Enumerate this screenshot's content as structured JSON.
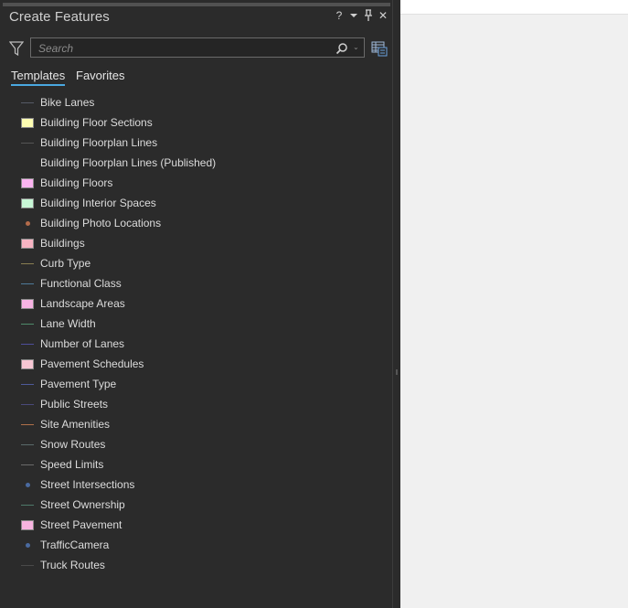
{
  "pane": {
    "title": "Create Features",
    "title_buttons": {
      "help": "?",
      "menu_icon": "chevron-down-icon",
      "pin_icon": "pin-icon",
      "close": "✕"
    }
  },
  "search": {
    "placeholder": "Search",
    "filter_icon": "filter-icon",
    "search_icon": "search-icon",
    "options_icon": "table-icon"
  },
  "tabs": [
    {
      "label": "Templates",
      "active": true
    },
    {
      "label": "Favorites",
      "active": false
    }
  ],
  "templates": [
    {
      "label": "Bike Lanes",
      "sym": "line",
      "color": "#555a66"
    },
    {
      "label": "Building Floor Sections",
      "sym": "poly",
      "color": "#ffffb3"
    },
    {
      "label": "Building Floorplan Lines",
      "sym": "line",
      "color": "#555555"
    },
    {
      "label": "Building Floorplan Lines (Published)",
      "sym": "none",
      "color": ""
    },
    {
      "label": "Building Floors",
      "sym": "poly",
      "color": "#fbb4f0"
    },
    {
      "label": "Building Interior Spaces",
      "sym": "poly",
      "color": "#c8f7d6"
    },
    {
      "label": "Building Photo Locations",
      "sym": "point",
      "color": "#b36b4a"
    },
    {
      "label": "Buildings",
      "sym": "poly",
      "color": "#f7b4c3"
    },
    {
      "label": "Curb Type",
      "sym": "line",
      "color": "#8a7f52"
    },
    {
      "label": "Functional Class",
      "sym": "line",
      "color": "#4e7a9a"
    },
    {
      "label": "Landscape Areas",
      "sym": "poly",
      "color": "#f7b4e3"
    },
    {
      "label": "Lane Width",
      "sym": "line",
      "color": "#4e8a6a"
    },
    {
      "label": "Number of Lanes",
      "sym": "line",
      "color": "#4e4e9a"
    },
    {
      "label": "Pavement Schedules",
      "sym": "poly",
      "color": "#f7c7d4"
    },
    {
      "label": "Pavement Type",
      "sym": "line",
      "color": "#4e5a9a"
    },
    {
      "label": "Public Streets",
      "sym": "line",
      "color": "#4a4a7a"
    },
    {
      "label": "Site Amenities",
      "sym": "line",
      "color": "#b0704a"
    },
    {
      "label": "Snow Routes",
      "sym": "line",
      "color": "#5a6a6a"
    },
    {
      "label": "Speed Limits",
      "sym": "line",
      "color": "#6a6a6a"
    },
    {
      "label": "Street Intersections",
      "sym": "point",
      "color": "#4a6aa0"
    },
    {
      "label": "Street Ownership",
      "sym": "line",
      "color": "#4e7a6a"
    },
    {
      "label": "Street Pavement",
      "sym": "poly",
      "color": "#f7b4e0"
    },
    {
      "label": "TrafficCamera",
      "sym": "point",
      "color": "#4a6aa0"
    },
    {
      "label": "Truck Routes",
      "sym": "line",
      "color": "#4a4a4a"
    }
  ]
}
